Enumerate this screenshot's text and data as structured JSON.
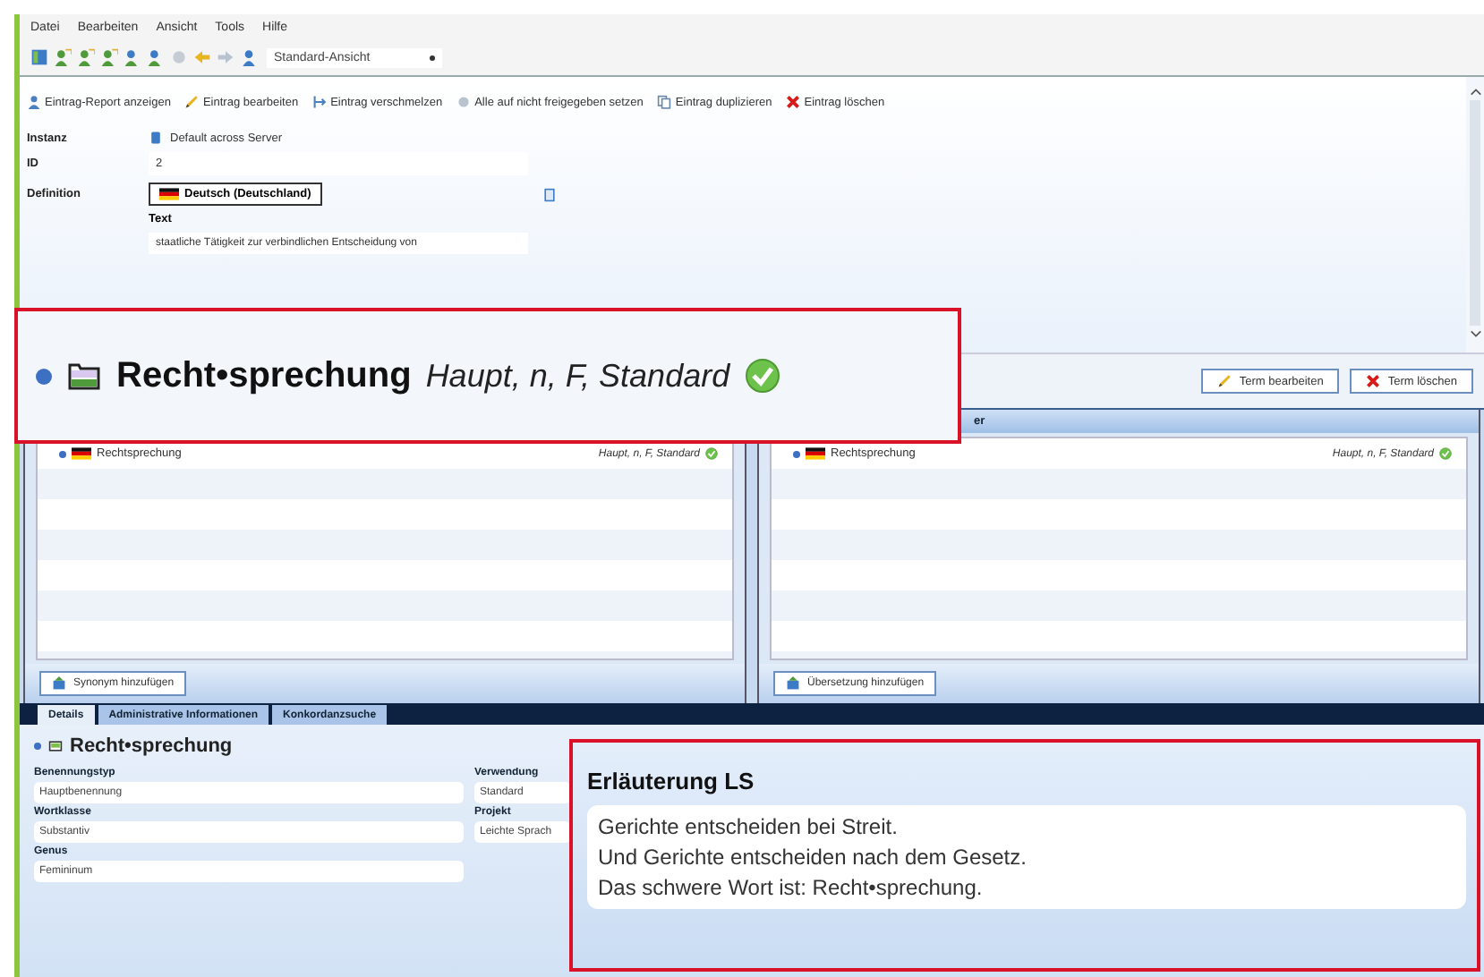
{
  "menu": [
    "Datei",
    "Bearbeiten",
    "Ansicht",
    "Tools",
    "Hilfe"
  ],
  "toolbar": {
    "view": "Standard-Ansicht"
  },
  "actions": [
    {
      "label": "Eintrag-Report anzeigen",
      "kind": "report"
    },
    {
      "label": "Eintrag bearbeiten",
      "kind": "edit"
    },
    {
      "label": "Eintrag verschmelzen",
      "kind": "merge"
    },
    {
      "label": "Alle auf nicht freigegeben setzen",
      "kind": "release"
    },
    {
      "label": "Eintrag duplizieren",
      "kind": "duplicate"
    },
    {
      "label": "Eintrag löschen",
      "kind": "delete"
    }
  ],
  "entry": {
    "instance_label": "Instanz",
    "instance": "Default across Server",
    "id_label": "ID",
    "id": "2",
    "definition_label": "Definition",
    "language": "Deutsch (Deutschland)",
    "text_label": "Text",
    "text": "staatliche Tätigkeit zur verbindlichen Entscheidung von"
  },
  "term_buttons": [
    {
      "label": "Term bearbeiten",
      "kind": "edit"
    },
    {
      "label": "Term löschen",
      "kind": "delete"
    }
  ],
  "panes": [
    {
      "rows": [
        {
          "term": "Rechtsprechung",
          "info": "Haupt, n, F, Standard",
          "approved": true
        }
      ],
      "button": "Synonym hinzufügen"
    },
    {
      "header": "er",
      "rows": [
        {
          "term": "Rechtsprechung",
          "info": "Haupt, n, F, Standard",
          "approved": true
        }
      ],
      "button": "Übersetzung hinzufügen"
    }
  ],
  "tabs": [
    {
      "label": "Details",
      "selected": true
    },
    {
      "label": "Administrative Informationen",
      "selected": false
    },
    {
      "label": "Konkordanzsuche",
      "selected": false
    }
  ],
  "details": {
    "title": "Recht•sprechung",
    "left_fields": [
      {
        "label": "Benennungstyp",
        "value": "Hauptbenennung"
      },
      {
        "label": "Wortklasse",
        "value": "Substantiv"
      },
      {
        "label": "Genus",
        "value": "Femininum"
      }
    ],
    "right_fields": [
      {
        "label": "Verwendung",
        "value": "Standard"
      },
      {
        "label": "Projekt",
        "value": "Leichte Sprach"
      }
    ]
  },
  "callouts": [
    {
      "kind": "term",
      "term": "Recht•sprechung",
      "info": "Haupt, n, F, Standard",
      "approved": true
    },
    {
      "kind": "explanation",
      "title": "Erläuterung LS",
      "lines": [
        "Gerichte entscheiden bei Streit.",
        "Und Gerichte entscheiden nach dem Gesetz.",
        "Das schwere Wort ist: Recht•sprechung."
      ]
    }
  ]
}
